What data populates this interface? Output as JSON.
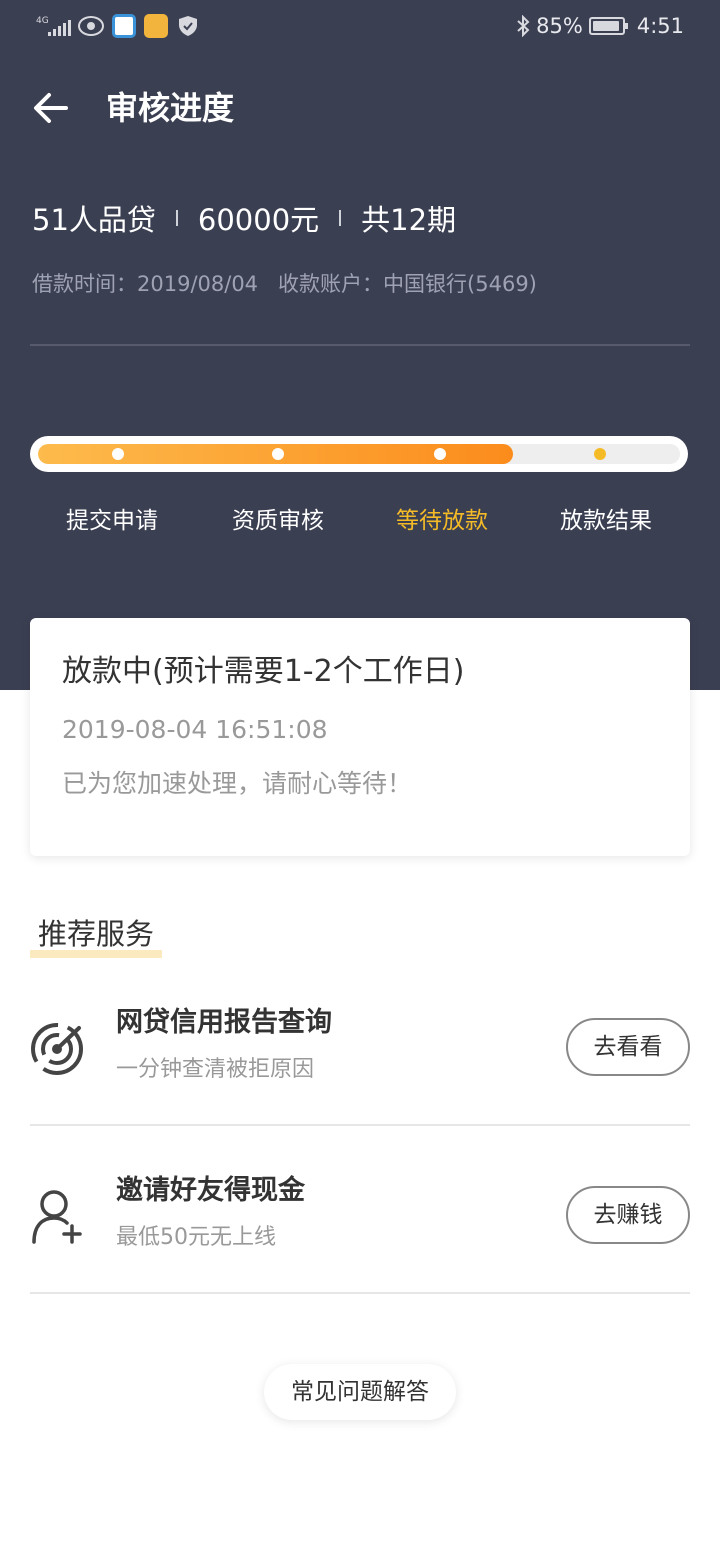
{
  "status_bar": {
    "network": "4G",
    "battery": "85%",
    "time": "4:51",
    "icons": [
      "signal-icon",
      "eye-icon",
      "app-icon",
      "mail-icon",
      "shield-icon",
      "bluetooth-icon",
      "battery-icon"
    ]
  },
  "header": {
    "back_icon": "arrow-left-icon",
    "title": "审核进度"
  },
  "loan": {
    "product": "51人品贷",
    "amount": "60000元",
    "periods": "共12期",
    "borrow_time": "借款时间：2019/08/04",
    "account": "收款账户：中国银行(5469)"
  },
  "progress": {
    "filled_fraction": 0.74,
    "steps": [
      {
        "label": "提交申请",
        "state": "done"
      },
      {
        "label": "资质审核",
        "state": "done"
      },
      {
        "label": "等待放款",
        "state": "current"
      },
      {
        "label": "放款结果",
        "state": "pending"
      }
    ],
    "colors": {
      "fill_start": "#fdbb4c",
      "fill_end": "#fb8c1c",
      "active_label": "#f5bb27",
      "header_bg": "#3b3f52"
    }
  },
  "status_card": {
    "title": "放款中(预计需要1-2个工作日)",
    "time": "2019-08-04 16:51:08",
    "note": "已为您加速处理，请耐心等待！"
  },
  "recommend": {
    "title": "推荐服务",
    "items": [
      {
        "icon": "radar-icon",
        "name": "网贷信用报告查询",
        "desc": "一分钟查清被拒原因",
        "button": "去看看"
      },
      {
        "icon": "add-user-icon",
        "name": "邀请好友得现金",
        "desc": "最低50元无上线",
        "button": "去赚钱"
      }
    ]
  },
  "faq": {
    "label": "常见问题解答"
  }
}
